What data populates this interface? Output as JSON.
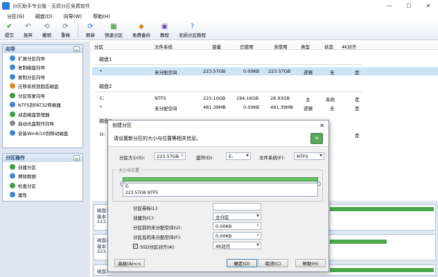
{
  "window": {
    "title": "分区助手专业版 - 无损分区免费软件",
    "controls": [
      "—",
      "☐",
      "✕"
    ]
  },
  "menu": [
    "分区(G)",
    "磁盘(D)",
    "向导(W)",
    "帮助(H)"
  ],
  "toolbar": [
    {
      "label": "提交",
      "icon": "submit-icon"
    },
    {
      "label": "放弃",
      "icon": "discard-icon"
    },
    {
      "label": "撤销",
      "icon": "undo-icon"
    },
    {
      "label": "重做",
      "icon": "redo-icon"
    },
    {
      "label": "刷新",
      "icon": "refresh-icon"
    },
    {
      "label": "快速分区",
      "icon": "quick-partition-icon"
    },
    {
      "label": "免费备份",
      "icon": "backup-icon"
    },
    {
      "label": "教程",
      "icon": "tutorial-icon"
    },
    {
      "label": "无损分区教程",
      "icon": "help-icon"
    }
  ],
  "wizard_panel": {
    "title": "向导",
    "items": [
      "扩展分区向导",
      "复制磁盘向导",
      "复制分区向导",
      "迁移系统到固态磁盘",
      "分区恢复向导",
      "NTFS到FAT32转换器",
      "动态磁盘管理器",
      "启动光盘制作向导",
      "安装Win8/10到移动磁盘"
    ]
  },
  "ops_panel": {
    "title": "分区操作",
    "items": [
      "创建分区",
      "擦除数据",
      "检查分区",
      "属性"
    ]
  },
  "columns": [
    "分区",
    "文件系统",
    "容量",
    "已使用",
    "未使用",
    "类型",
    "状态",
    "4K对齐"
  ],
  "disk1": {
    "label": "磁盘1",
    "rows": [
      {
        "name": "*",
        "fs": "未分配空间",
        "cap": "223.57GB",
        "used": "0.00KB",
        "free": "223.57GB",
        "type": "逻辑",
        "status": "无",
        "align": "是"
      }
    ]
  },
  "disk2": {
    "label": "磁盘2",
    "rows": [
      {
        "name": "C:",
        "fs": "NTFS",
        "cap": "223.10GB",
        "used": "194.16GB",
        "free": "28.93GB",
        "type": "主",
        "status": "系统",
        "align": "是"
      },
      {
        "name": "*",
        "fs": "未分配空间",
        "cap": "481.39MB",
        "used": "0.00KB",
        "free": "481.39MB",
        "type": "逻辑",
        "status": "无",
        "align": "是"
      }
    ]
  },
  "disk3_label": "磁盘3",
  "disk3_row_name": "D:",
  "disk_map": [
    {
      "label": "磁盘1",
      "sub1": "基本",
      "sub2": "223.5"
    },
    {
      "label": "磁盘2",
      "sub1": "基本",
      "sub2": "223.5"
    },
    {
      "label": "磁盘3",
      "sub1": "",
      "sub2": ""
    }
  ],
  "dialog": {
    "title": "创建分区",
    "close": "✕",
    "header": "请设置新分区的大小与位置等相关信息。",
    "size_label": "分区大小(S):",
    "size_value": "223.57GB",
    "drive_label": "盘符(D):",
    "drive_value": "E:",
    "fs_label": "文件系统(F):",
    "fs_value": "NTFS",
    "group_label": "大小与位置",
    "partition_title": "E:",
    "partition_info": "223.57GB NTFS",
    "volume_label": "分区卷标(L):",
    "volume_value": "",
    "create_as_label": "创建为(C):",
    "create_as_value": "主分区",
    "before_label": "分区前的未分配空间(U):",
    "before_value": "0.00KB",
    "after_label": "分区后的未分配空间(F):",
    "after_value": "0.00KB",
    "ssd_label": "SSD分区对齐(A):",
    "ssd_value": "4K对齐",
    "advanced": "高级(A)<<",
    "ok": "确定(O)",
    "cancel": "取消(C)",
    "help": "帮助(H)"
  }
}
